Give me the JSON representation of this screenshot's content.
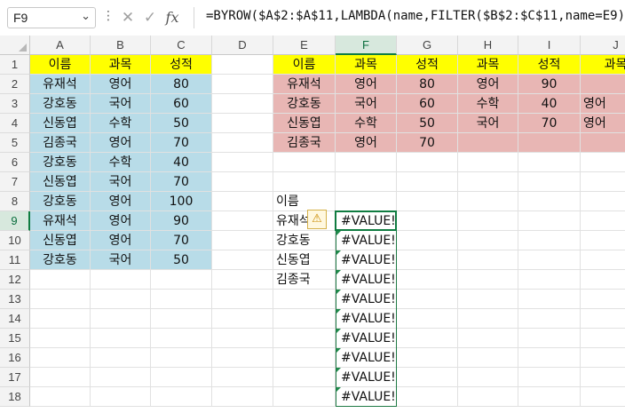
{
  "namebox": {
    "value": "F9",
    "dropdown_icon": "chevron-down-icon"
  },
  "formula_bar": {
    "cancel_icon": "close-icon",
    "enter_icon": "check-icon",
    "fx_label": "fx",
    "formula": "=BYROW($A$2:$A$11,LAMBDA(name,FILTER($B$2:$C$11,name=E9)))"
  },
  "columns": [
    "A",
    "B",
    "C",
    "D",
    "E",
    "F",
    "G",
    "H",
    "I",
    "J"
  ],
  "rows": [
    "1",
    "2",
    "3",
    "4",
    "5",
    "6",
    "7",
    "8",
    "9",
    "10",
    "11",
    "12",
    "13",
    "14",
    "15",
    "16",
    "17",
    "18"
  ],
  "selected_cell": "F9",
  "colors": {
    "header_yellow": "#ffff00",
    "source_blue": "#b8dce8",
    "result_pink": "#e8b6b4",
    "excel_green": "#107c41"
  },
  "cells": {
    "A1": "이름",
    "B1": "과목",
    "C1": "성적",
    "A2": "유재석",
    "B2": "영어",
    "C2": "80",
    "A3": "강호동",
    "B3": "국어",
    "C3": "60",
    "A4": "신동엽",
    "B4": "수학",
    "C4": "50",
    "A5": "김종국",
    "B5": "영어",
    "C5": "70",
    "A6": "강호동",
    "B6": "수학",
    "C6": "40",
    "A7": "신동엽",
    "B7": "국어",
    "C7": "70",
    "A8": "강호동",
    "B8": "영어",
    "C8": "100",
    "A9": "유재석",
    "B9": "영어",
    "C9": "90",
    "A10": "신동엽",
    "B10": "영어",
    "C10": "70",
    "A11": "강호동",
    "B11": "국어",
    "C11": "50",
    "E1": "이름",
    "F1": "과목",
    "G1": "성적",
    "H1": "과목",
    "I1": "성적",
    "J1": "과목",
    "E2": "유재석",
    "F2": "영어",
    "G2": "80",
    "H2": "영어",
    "I2": "90",
    "E3": "강호동",
    "F3": "국어",
    "G3": "60",
    "H3": "수학",
    "I3": "40",
    "J3": "영어",
    "E4": "신동엽",
    "F4": "수학",
    "G4": "50",
    "H4": "국어",
    "I4": "70",
    "J4": "영어",
    "E5": "김종국",
    "F5": "영어",
    "G5": "70",
    "E8": "이름",
    "E9": "유재석",
    "E10": "강호동",
    "E11": "신동엽",
    "E12": "김종국",
    "F9": "#VALUE!",
    "F10": "#VALUE!",
    "F11": "#VALUE!",
    "F12": "#VALUE!",
    "F13": "#VALUE!",
    "F14": "#VALUE!",
    "F15": "#VALUE!",
    "F16": "#VALUE!",
    "F17": "#VALUE!",
    "F18": "#VALUE!"
  },
  "error_indicator_icon": "warning-icon"
}
